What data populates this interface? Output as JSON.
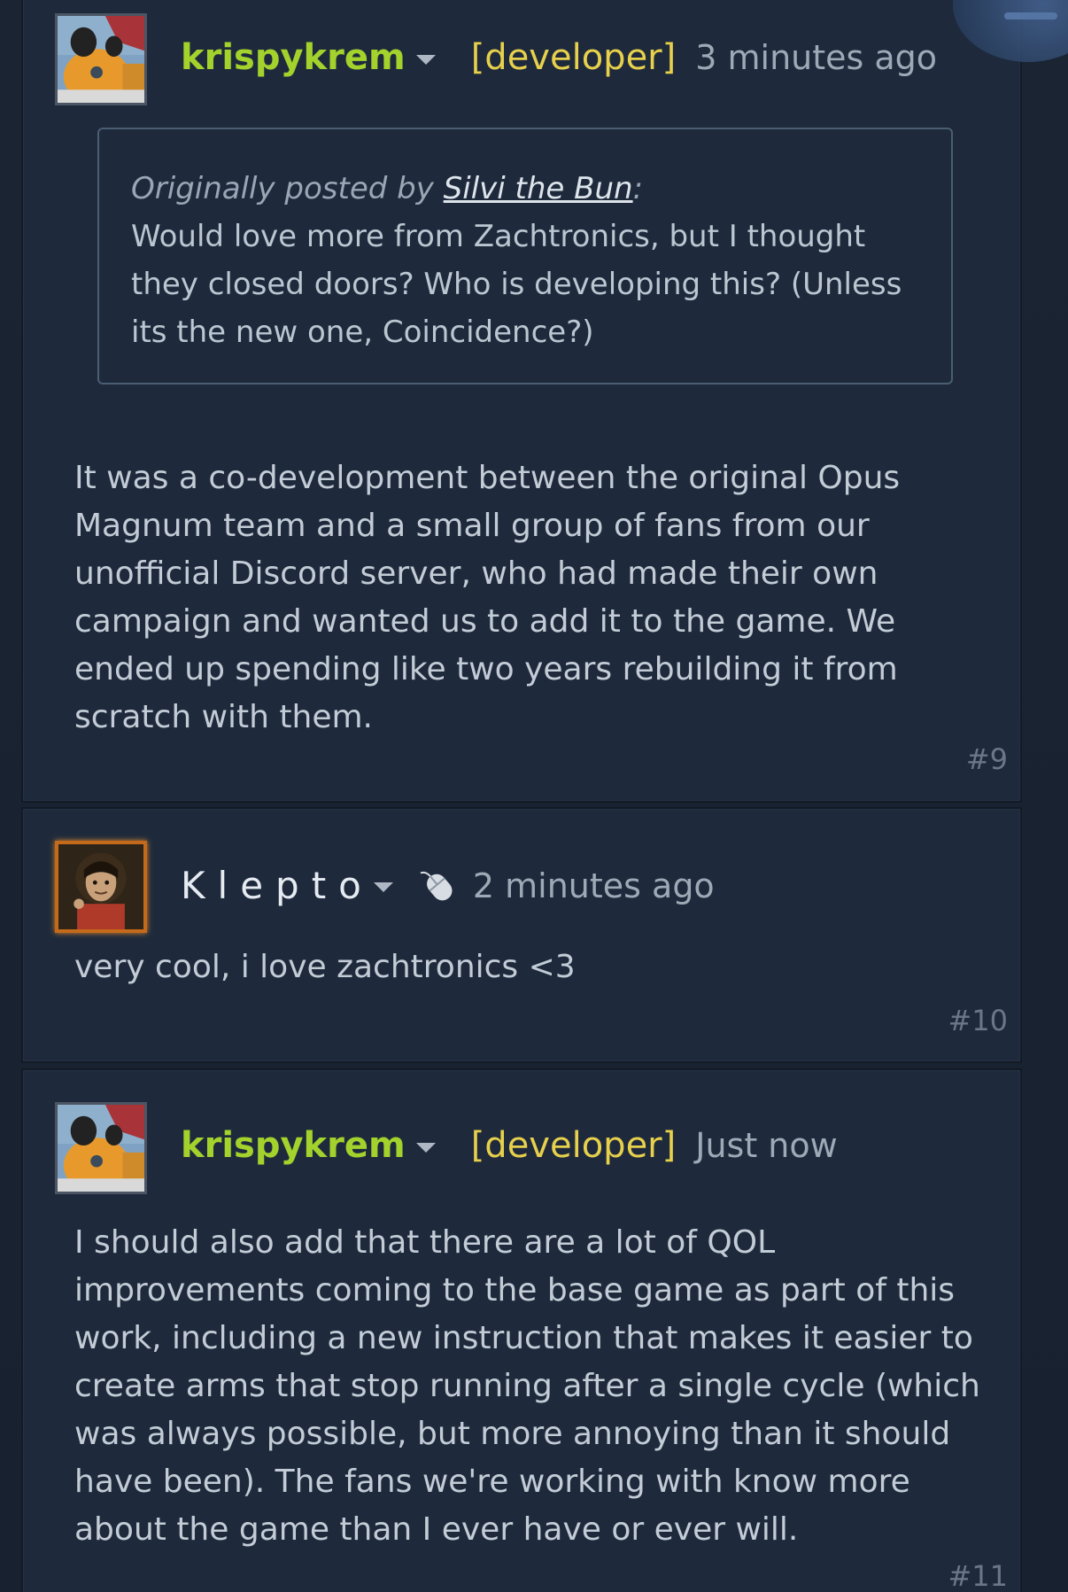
{
  "posts": [
    {
      "id": "9",
      "username": "krispykrem",
      "tag": "[developer]",
      "time": "3 minutes ago",
      "quote": {
        "prefix": "Originally posted by ",
        "author": "Silvi the Bun",
        "suffix": ":",
        "text": "Would love more from Zachtronics, but I thought they closed doors? Who is developing this? (Unless its the new one, Coincidence?)"
      },
      "text": "It was a co-development between the original Opus Magnum team and a small group of fans from our unofficial Discord server, who had made their own campaign and wanted us to add it to the game. We ended up spending like two years rebuilding it from scratch with them.",
      "number": "#9"
    },
    {
      "id": "10",
      "username": "Klepto",
      "time": "2 minutes ago",
      "icon": "mouse-icon",
      "text": "very cool, i love zachtronics <3",
      "number": "#10"
    },
    {
      "id": "11",
      "username": "krispykrem",
      "tag": "[developer]",
      "time": "Just now",
      "text": "I should also add that there are a lot of QOL improvements coming to the base game as part of this work, including a new instruction that makes it easier to create arms that stop running after a single cycle (which was always possible, but more annoying than it should have been). The fans we're working with know more about the game than I ever have or ever will.",
      "number": "#11"
    }
  ],
  "colors": {
    "username_developer": "#a4d22c",
    "developer_tag": "#e7d04b",
    "post_background": "#1e2a3c",
    "page_background": "#16202d"
  }
}
